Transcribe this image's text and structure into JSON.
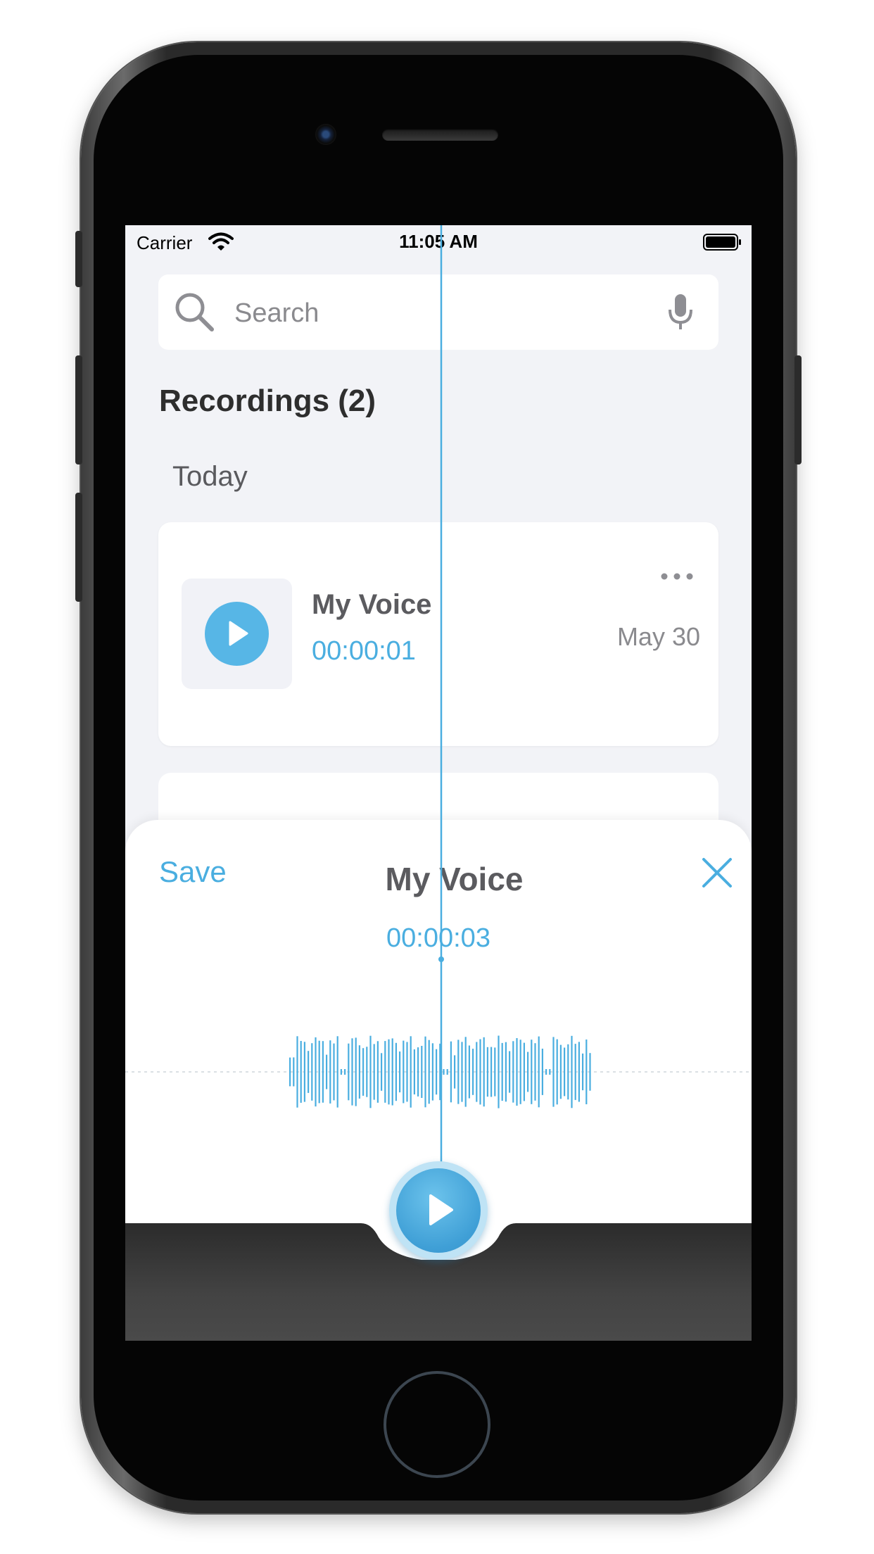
{
  "status_bar": {
    "carrier": "Carrier",
    "time": "11:05 AM"
  },
  "search": {
    "placeholder": "Search"
  },
  "recordings": {
    "title": "Recordings (2)",
    "group_label": "Today",
    "items": [
      {
        "title": "My Voice",
        "duration": "00:00:01",
        "date": "May 30"
      }
    ]
  },
  "player": {
    "save_label": "Save",
    "title": "My Voice",
    "timestamp": "00:00:03"
  },
  "colors": {
    "accent": "#4aaee0",
    "background": "#f2f3f7",
    "card": "#ffffff",
    "text_dark": "#2e2e2e",
    "text_muted": "#8a8a8e"
  },
  "icons": [
    "wifi-icon",
    "battery-icon",
    "search-icon",
    "microphone-icon",
    "play-icon",
    "more-icon",
    "close-icon"
  ]
}
